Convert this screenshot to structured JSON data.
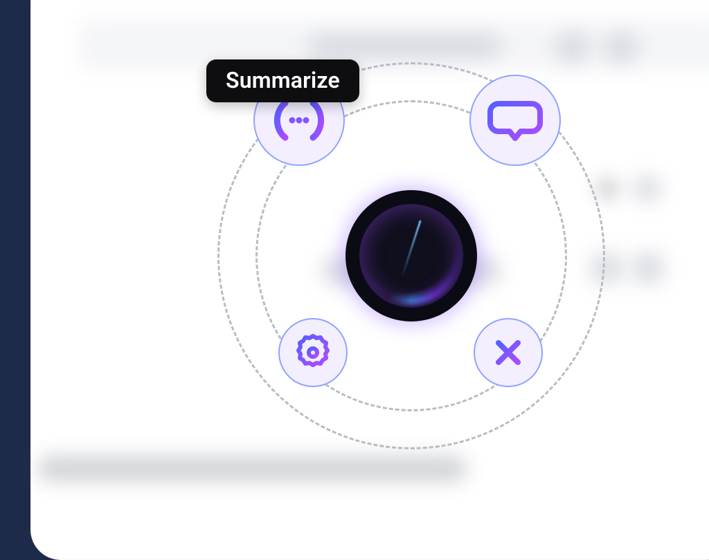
{
  "tooltip": {
    "summarize_label": "Summarize"
  },
  "actions": {
    "summarize": {
      "icon": "summarize-icon"
    },
    "chat": {
      "icon": "chat-icon"
    },
    "settings": {
      "icon": "settings-icon"
    },
    "close": {
      "icon": "close-icon"
    }
  },
  "orb": {
    "name": "ai-assistant-orb"
  },
  "colors": {
    "gradient_a": "#5560ff",
    "gradient_b": "#b04bff",
    "satellite_fill": "#f3efff",
    "satellite_border": "#8fa3ff",
    "tooltip_bg": "#0e0e10",
    "tooltip_fg": "#ffffff"
  }
}
